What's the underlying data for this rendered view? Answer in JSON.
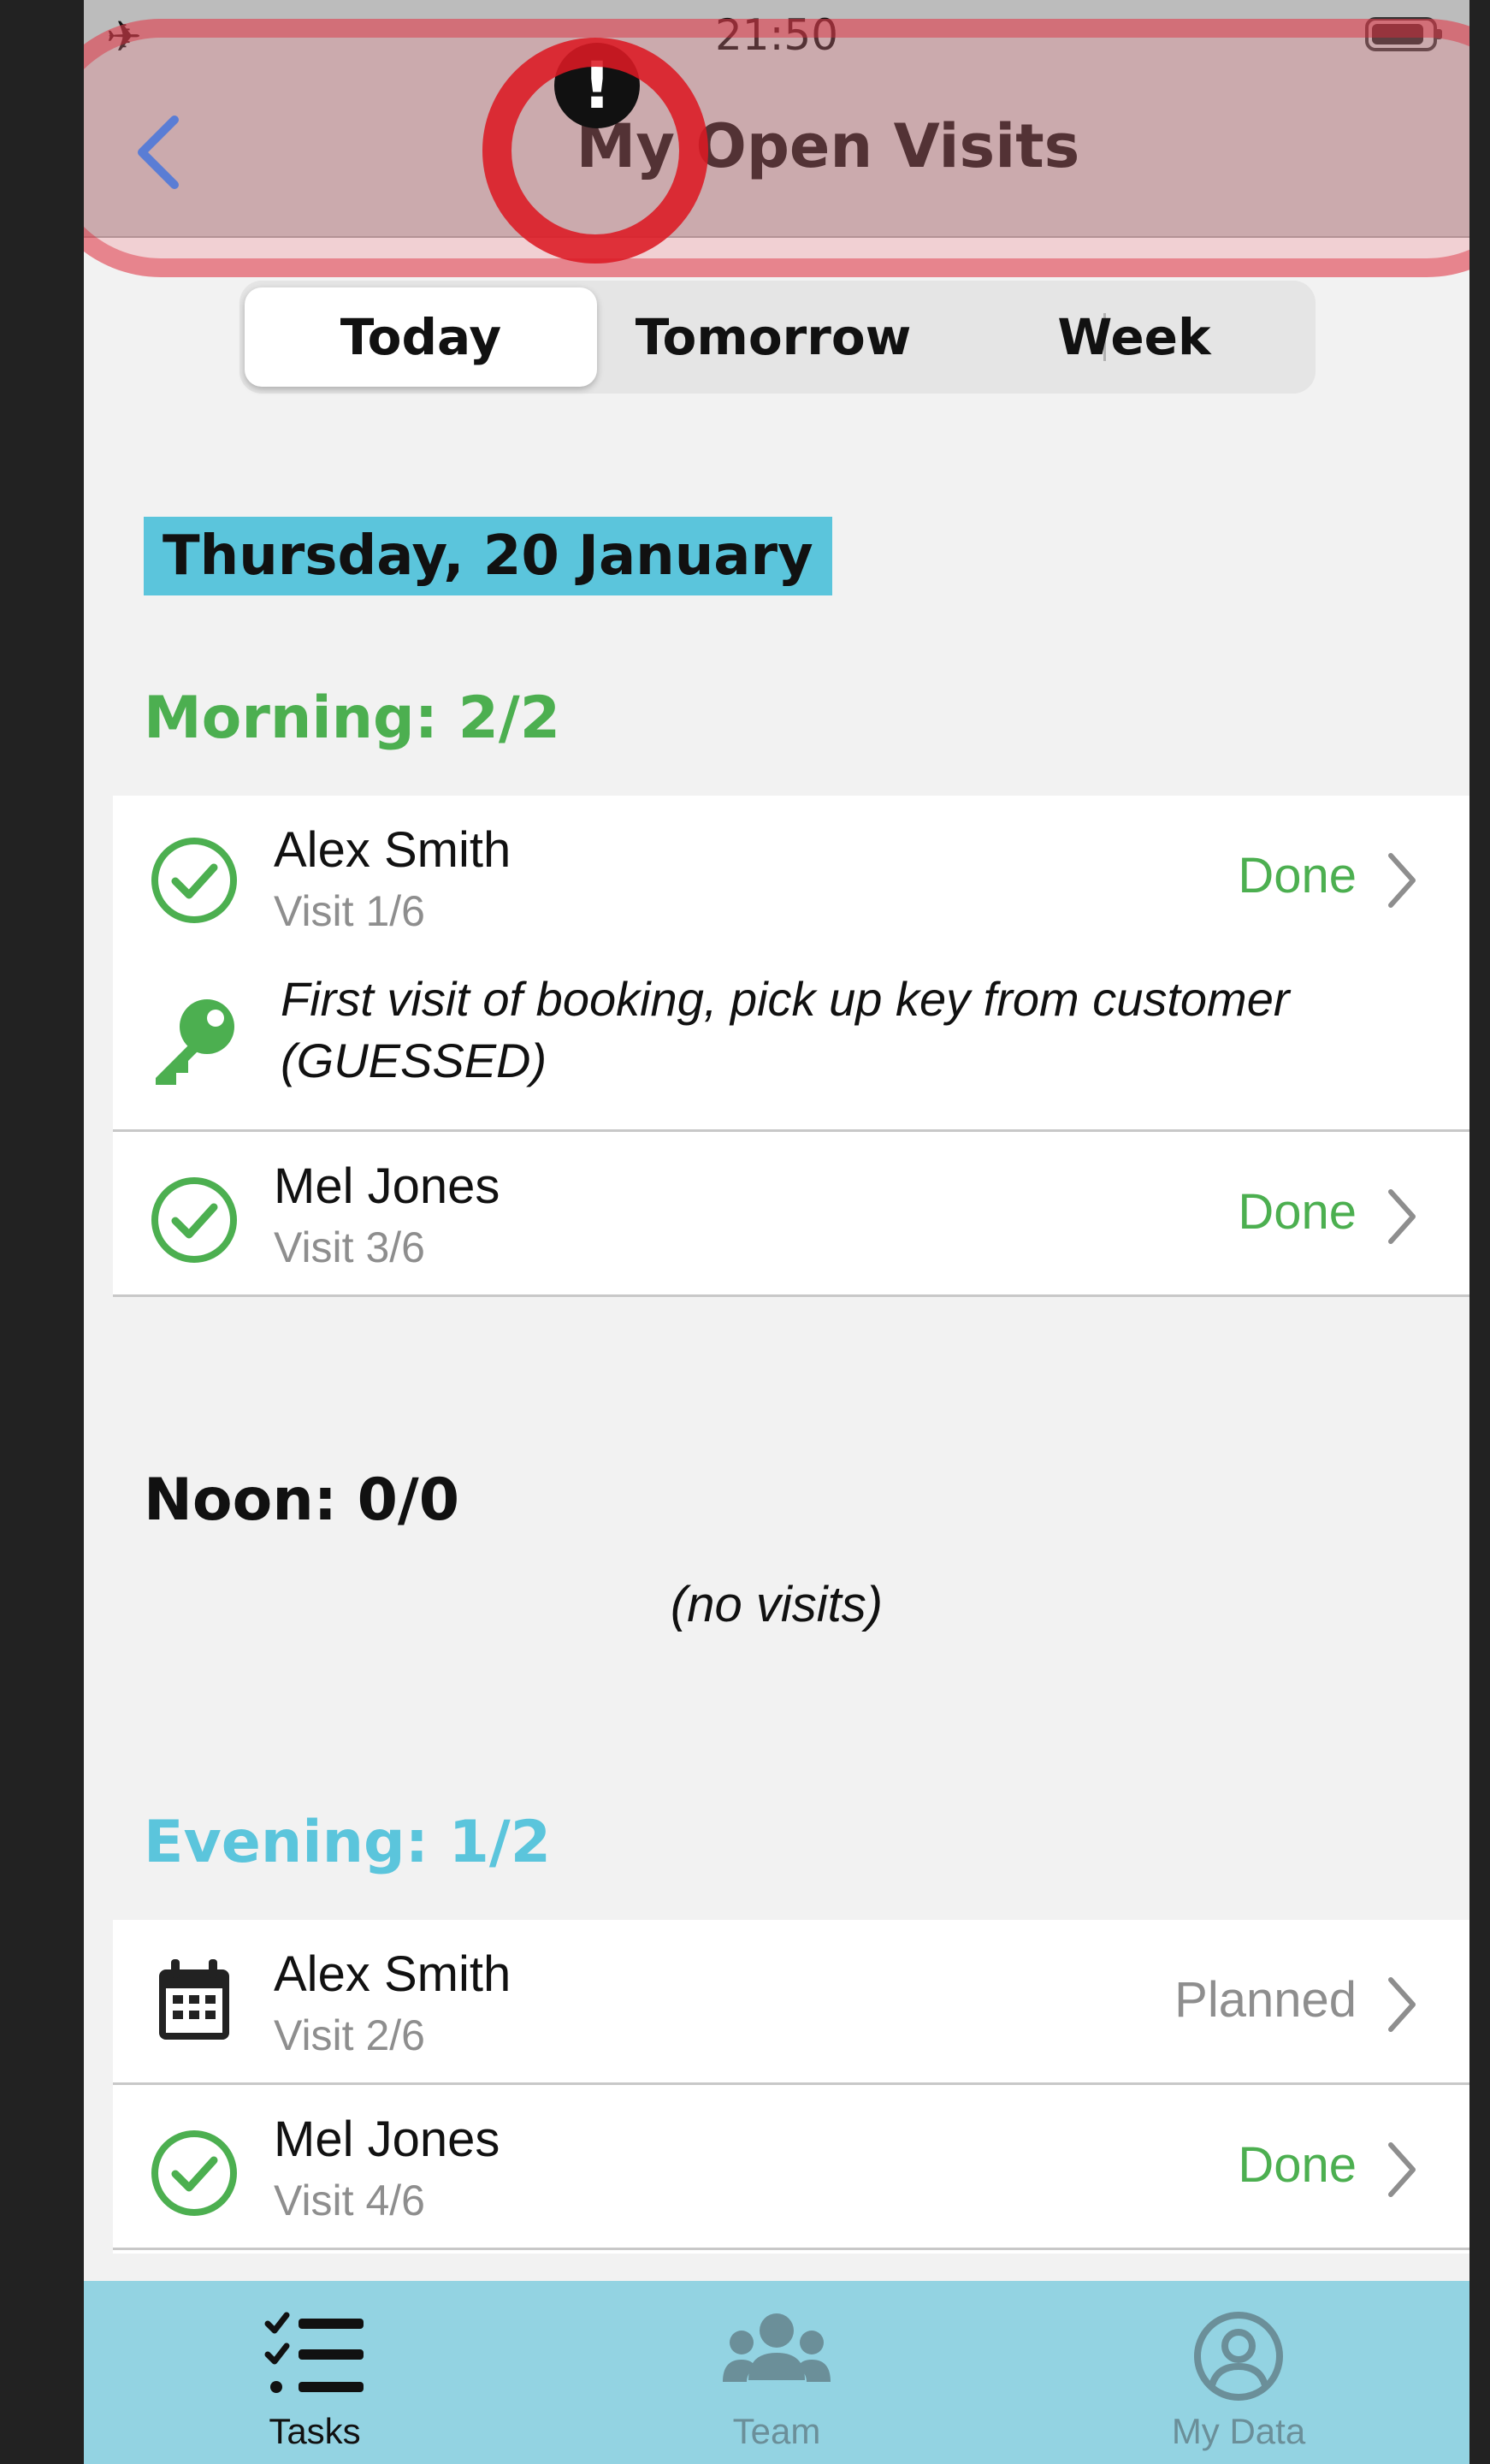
{
  "status_bar": {
    "time": "21:50",
    "plane_icon": "airplane-icon",
    "battery_icon": "battery-icon"
  },
  "nav": {
    "title": "My Open Visits",
    "back_icon": "chevron-left-icon",
    "alert_icon": "exclamation-circle-icon"
  },
  "segments": [
    {
      "label": "Today",
      "selected": true
    },
    {
      "label": "Tomorrow",
      "selected": false
    },
    {
      "label": "Week",
      "selected": false
    }
  ],
  "date_header": "Thursday, 20 January",
  "sections": {
    "morning": {
      "title": "Morning: 2/2",
      "color": "#4caf50",
      "visits": [
        {
          "name": "Alex Smith",
          "visit": "Visit 1/6",
          "status": "Done",
          "icon": "check-circle-icon",
          "note": "First visit of booking, pick up key from customer (GUESSED)",
          "note_icon": "key-icon"
        },
        {
          "name": "Mel Jones",
          "visit": "Visit 3/6",
          "status": "Done",
          "icon": "check-circle-icon"
        }
      ]
    },
    "noon": {
      "title": "Noon: 0/0",
      "color": "#111111",
      "empty_text": "(no visits)"
    },
    "evening": {
      "title": "Evening: 1/2",
      "color": "#5bc5dc",
      "visits": [
        {
          "name": "Alex Smith",
          "visit": "Visit 2/6",
          "status": "Planned",
          "icon": "calendar-icon"
        },
        {
          "name": "Mel Jones",
          "visit": "Visit 4/6",
          "status": "Done",
          "icon": "check-circle-icon"
        }
      ]
    }
  },
  "colors": {
    "done": "#4caf50",
    "planned": "#8e8e8e",
    "accent_blue": "#1a7cf5",
    "tabbar": "#93d3e2"
  },
  "tabs": [
    {
      "label": "Tasks",
      "icon": "tasks-list-icon",
      "selected": true
    },
    {
      "label": "Team",
      "icon": "team-icon",
      "selected": false
    },
    {
      "label": "My Data",
      "icon": "user-circle-icon",
      "selected": false
    }
  ]
}
